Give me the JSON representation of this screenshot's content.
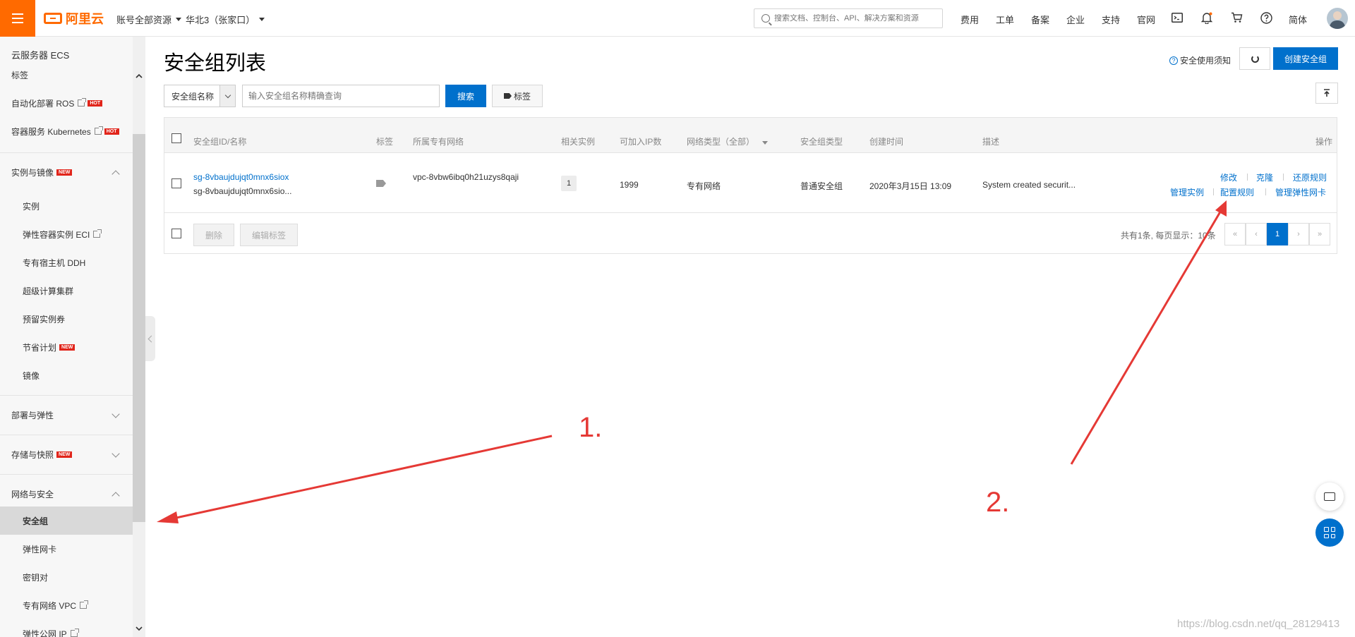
{
  "topbar": {
    "logo": "阿里云",
    "account_dropdown": "账号全部资源",
    "region_dropdown": "华北3（张家口）",
    "search_placeholder": "搜索文档、控制台、API、解决方案和资源",
    "links": [
      "费用",
      "工单",
      "备案",
      "企业",
      "支持",
      "官网"
    ],
    "language": "简体"
  },
  "sidebar": {
    "header": "云服务器 ECS",
    "top_items": [
      {
        "label": "标签"
      },
      {
        "label": "自动化部署 ROS",
        "external": true,
        "badge": "HOT"
      },
      {
        "label": "容器服务 Kubernetes",
        "external": true,
        "badge": "HOT"
      }
    ],
    "group_instances": {
      "label": "实例与镜像",
      "badge": "NEW"
    },
    "instance_items": [
      {
        "label": "实例"
      },
      {
        "label": "弹性容器实例 ECI",
        "external": true
      },
      {
        "label": "专有宿主机 DDH"
      },
      {
        "label": "超级计算集群"
      },
      {
        "label": "预留实例券"
      },
      {
        "label": "节省计划",
        "badge": "NEW"
      },
      {
        "label": "镜像"
      }
    ],
    "group_deploy": {
      "label": "部署与弹性"
    },
    "group_storage": {
      "label": "存储与快照",
      "badge": "NEW"
    },
    "group_network": {
      "label": "网络与安全"
    },
    "network_items": [
      {
        "label": "安全组",
        "active": true
      },
      {
        "label": "弹性网卡"
      },
      {
        "label": "密钥对"
      },
      {
        "label": "专有网络 VPC",
        "external": true
      },
      {
        "label": "弹性公网 IP",
        "external": true
      }
    ]
  },
  "main": {
    "title": "安全组列表",
    "help_link": "安全使用须知",
    "create_button": "创建安全组",
    "filter": {
      "select_value": "安全组名称",
      "input_placeholder": "输入安全组名称精确查询",
      "search_button": "搜索",
      "tag_button": "标签"
    },
    "table": {
      "columns": [
        "安全组ID/名称",
        "标签",
        "所属专有网络",
        "相关实例",
        "可加入IP数",
        "网络类型（全部）",
        "安全组类型",
        "创建时间",
        "描述",
        "操作"
      ],
      "rows": [
        {
          "id": "sg-8vbaujdujqt0mnx6siox",
          "name": "sg-8vbaujdujqt0mnx6sio...",
          "vpc": "vpc-8vbw6ibq0h21uzys8qaji",
          "instances": "1",
          "ip_count": "1999",
          "network_type": "专有网络",
          "sg_type": "普通安全组",
          "created": "2020年3月15日 13:09",
          "description": "System created securit...",
          "actions_row1": [
            "修改",
            "克隆",
            "还原规则"
          ],
          "actions_row2": [
            "管理实例",
            "配置规则",
            "管理弹性网卡"
          ]
        }
      ]
    },
    "footer": {
      "delete_button": "删除",
      "edit_tags_button": "编辑标签",
      "summary": "共有1条, 每页显示：10条",
      "pages": [
        "«",
        "‹",
        "1",
        "›",
        "»"
      ]
    }
  },
  "annotations": {
    "label_1": "1.",
    "label_2": "2.",
    "color": "#e53935"
  },
  "watermark": "https://blog.csdn.net/qq_28129413"
}
